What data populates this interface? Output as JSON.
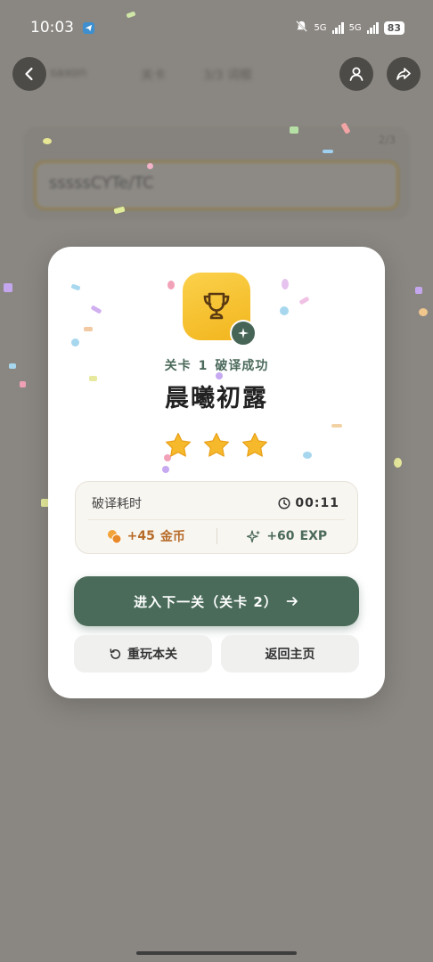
{
  "status_bar": {
    "time": "10:03",
    "network_1": "5G",
    "network_2": "5G",
    "battery": "83"
  },
  "background": {
    "header_text_1": "saxon",
    "header_text_2": "关卡",
    "header_text_3": "3/3 词根",
    "count_text": "2/3",
    "input_text": "sssssCYTe/TC"
  },
  "modal": {
    "level_label": "关卡",
    "level_number": "1",
    "status": "破译成功",
    "title": "晨曦初露",
    "stars": 3,
    "stats": {
      "time_label": "破译耗时",
      "time_value": "00:11",
      "coins_value": "+45",
      "coins_label": "金币",
      "exp_value": "+60",
      "exp_label": "EXP"
    },
    "next_button": "进入下一关（关卡 2）",
    "replay_button": "重玩本关",
    "home_button": "返回主页"
  },
  "colors": {
    "primary": "#4a6b5a",
    "gold": "#f5c02a",
    "overlay": "#8a8782"
  },
  "icons": [
    "back-icon",
    "user-icon",
    "share-icon",
    "trophy-icon",
    "sparkle-icon",
    "star-icon",
    "clock-icon",
    "coins-icon",
    "arrow-right-icon",
    "replay-icon"
  ]
}
